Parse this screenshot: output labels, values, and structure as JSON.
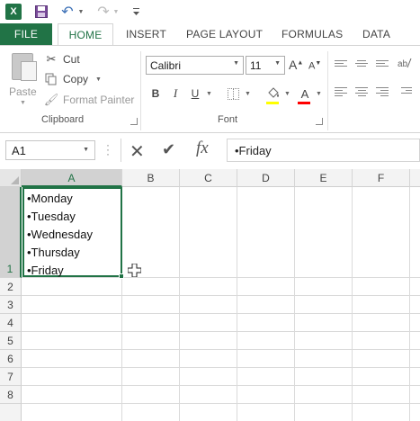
{
  "qat": {
    "app_icon": "excel-icon",
    "app_letter": "X",
    "save_icon": "save-icon",
    "undo_icon": "undo-icon",
    "redo_icon": "redo-icon",
    "customize_icon": "customize-qat-icon"
  },
  "tabs": [
    {
      "label": "FILE"
    },
    {
      "label": "HOME"
    },
    {
      "label": "INSERT"
    },
    {
      "label": "PAGE LAYOUT"
    },
    {
      "label": "FORMULAS"
    },
    {
      "label": "DATA"
    }
  ],
  "ribbon": {
    "clipboard": {
      "paste": "Paste",
      "cut": "Cut",
      "copy": "Copy",
      "format_painter": "Format Painter",
      "label": "Clipboard"
    },
    "font": {
      "family": "Calibri",
      "size": "11",
      "bold": "B",
      "italic": "I",
      "underline": "U",
      "grow": "A",
      "shrink": "A",
      "font_color_letter": "A",
      "label": "Font",
      "fill_color": "#ffff00",
      "font_color": "#ff0000"
    }
  },
  "formula_bar": {
    "name_box": "A1",
    "content": "•Friday"
  },
  "sheet": {
    "columns": [
      "A",
      "B",
      "C",
      "D",
      "E",
      "F"
    ],
    "rows": [
      "1",
      "2",
      "3",
      "4",
      "5",
      "6",
      "7",
      "8"
    ],
    "selected_cell": "A1",
    "a1_lines": [
      "•Monday",
      "•Tuesday",
      "•Wednesday",
      "•Thursday",
      "•Friday"
    ]
  },
  "colors": {
    "accent": "#217346"
  }
}
